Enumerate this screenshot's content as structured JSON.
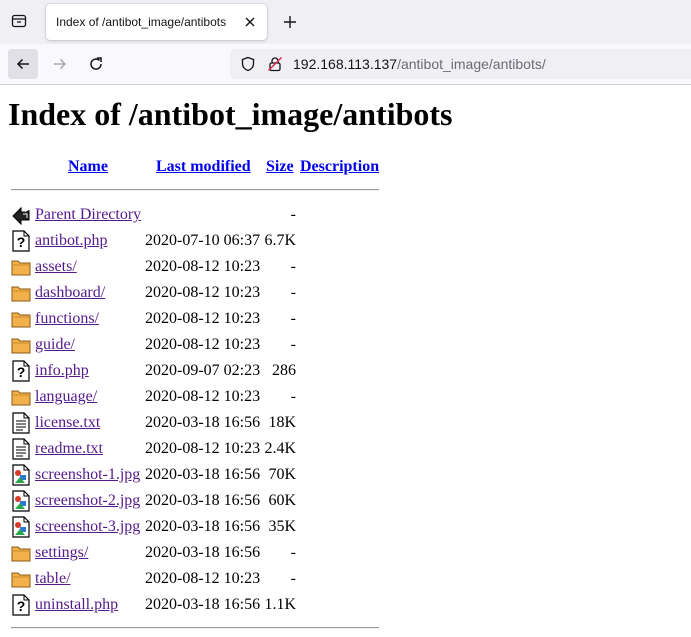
{
  "browser": {
    "tab_title": "Index of /antibot_image/antibots",
    "url_host": "192.168.113.137",
    "url_path": "/antibot_image/antibots/"
  },
  "page": {
    "heading": "Index of /antibot_image/antibots",
    "columns": {
      "name": "Name",
      "last_modified": "Last modified",
      "size": "Size",
      "description": "Description"
    },
    "entries": [
      {
        "icon": "back-icon",
        "name": "Parent Directory",
        "date": "",
        "size": "-"
      },
      {
        "icon": "unknown-file-icon",
        "name": "antibot.php",
        "date": "2020-07-10 06:37",
        "size": "6.7K"
      },
      {
        "icon": "folder-icon",
        "name": "assets/",
        "date": "2020-08-12 10:23",
        "size": "-"
      },
      {
        "icon": "folder-icon",
        "name": "dashboard/",
        "date": "2020-08-12 10:23",
        "size": "-"
      },
      {
        "icon": "folder-icon",
        "name": "functions/",
        "date": "2020-08-12 10:23",
        "size": "-"
      },
      {
        "icon": "folder-icon",
        "name": "guide/",
        "date": "2020-08-12 10:23",
        "size": "-"
      },
      {
        "icon": "unknown-file-icon",
        "name": "info.php",
        "date": "2020-09-07 02:23",
        "size": "286"
      },
      {
        "icon": "folder-icon",
        "name": "language/",
        "date": "2020-08-12 10:23",
        "size": "-"
      },
      {
        "icon": "text-file-icon",
        "name": "license.txt",
        "date": "2020-03-18 16:56",
        "size": "18K"
      },
      {
        "icon": "text-file-icon",
        "name": "readme.txt",
        "date": "2020-08-12 10:23",
        "size": "2.4K"
      },
      {
        "icon": "image-file-icon",
        "name": "screenshot-1.jpg",
        "date": "2020-03-18 16:56",
        "size": "70K"
      },
      {
        "icon": "image-file-icon",
        "name": "screenshot-2.jpg",
        "date": "2020-03-18 16:56",
        "size": "60K"
      },
      {
        "icon": "image-file-icon",
        "name": "screenshot-3.jpg",
        "date": "2020-03-18 16:56",
        "size": "35K"
      },
      {
        "icon": "folder-icon",
        "name": "settings/",
        "date": "2020-03-18 16:56",
        "size": "-"
      },
      {
        "icon": "folder-icon",
        "name": "table/",
        "date": "2020-08-12 10:23",
        "size": "-"
      },
      {
        "icon": "unknown-file-icon",
        "name": "uninstall.php",
        "date": "2020-03-18 16:56",
        "size": "1.1K"
      }
    ]
  }
}
